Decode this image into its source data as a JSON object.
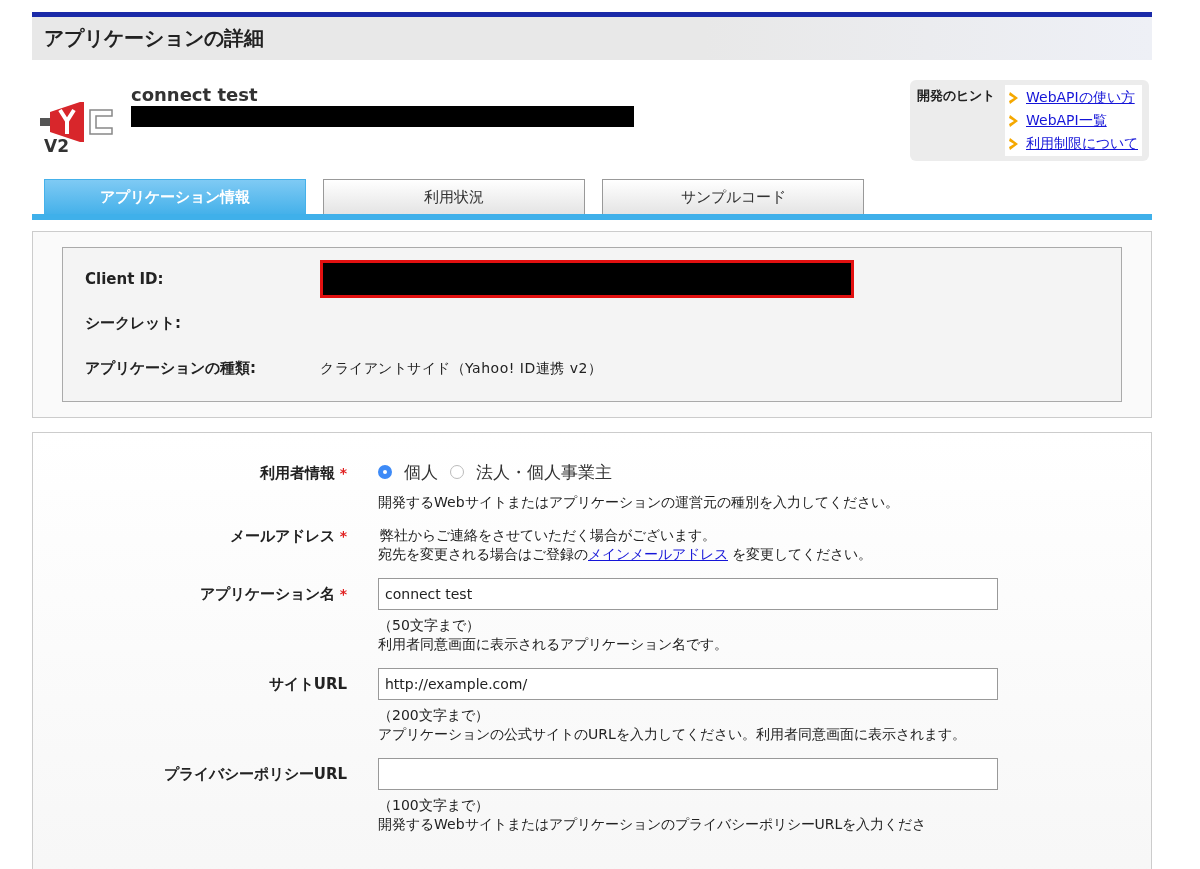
{
  "page_title": "アプリケーションの詳細",
  "app": {
    "name": "connect test",
    "badge": "V2"
  },
  "hints": {
    "label": "開発のヒント",
    "links": [
      {
        "label": "WebAPIの使い方"
      },
      {
        "label": "WebAPI一覧"
      },
      {
        "label": "利用制限について"
      }
    ]
  },
  "tabs": [
    {
      "label": "アプリケーション情報",
      "selected": true
    },
    {
      "label": "利用状況",
      "selected": false
    },
    {
      "label": "サンプルコード",
      "selected": false
    }
  ],
  "info": [
    {
      "label": "Client ID:",
      "kind": "redacted"
    },
    {
      "label": "シークレット:",
      "kind": "empty"
    },
    {
      "label": "アプリケーションの種類:",
      "kind": "text",
      "value": "クライアントサイド（Yahoo! ID連携 v2）"
    }
  ],
  "form": [
    {
      "label": "利用者情報",
      "mark": "*",
      "kind": "radio",
      "options": [
        {
          "label": "個人",
          "selected": true
        },
        {
          "label": "法人・個人事業主",
          "selected": false
        }
      ],
      "notes": [
        "開発するWebサイトまたはアプリケーションの運営元の種別を入力してください。"
      ]
    },
    {
      "label": "メールアドレス",
      "mark": "*",
      "kind": "text",
      "notes": [
        "弊社からご連絡をさせていただく場合がございます。"
      ],
      "link_line": {
        "before": "宛先を変更される場合はご登録の",
        "link": "メインメールアドレス",
        "after": " を変更してください。"
      }
    },
    {
      "label": "アプリケーション名",
      "mark": "*",
      "kind": "input",
      "value": "connect test",
      "notes": [
        "（50文字まで）",
        "利用者同意画面に表示されるアプリケーション名です。"
      ]
    },
    {
      "label": "サイトURL",
      "kind": "input",
      "value": "http://example.com/",
      "notes": [
        "（200文字まで）",
        "アプリケーションの公式サイトのURLを入力してください。利用者同意画面に表示されます。"
      ]
    },
    {
      "label": "プライバシーポリシーURL",
      "kind": "input",
      "notes": [
        "（100文字まで）",
        "開発するWebサイトまたはアプリケーションのプライバシーポリシーURLを入力くださ"
      ]
    }
  ]
}
